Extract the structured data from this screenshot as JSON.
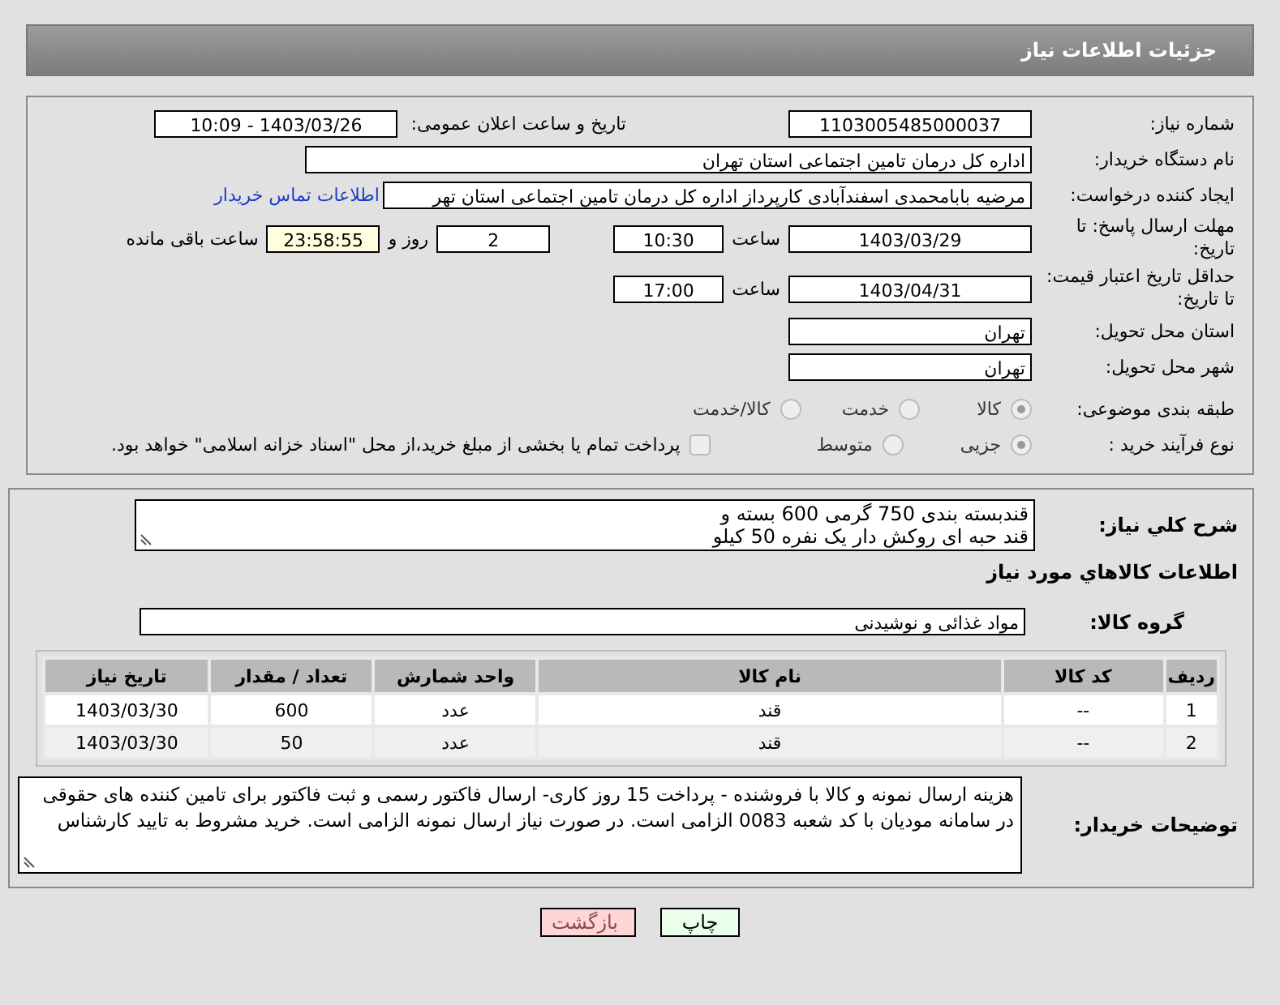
{
  "header": {
    "title": "جزئیات اطلاعات نیاز"
  },
  "need_number": {
    "label": "شماره نیاز:",
    "value": "1103005485000037"
  },
  "announce": {
    "label": "تاریخ و ساعت اعلان عمومی:",
    "value": "1403/03/26 - 10:09"
  },
  "buyer_org": {
    "label": "نام دستگاه خریدار:",
    "value": "اداره کل درمان تامین اجتماعی استان تهران"
  },
  "requester": {
    "label": "ایجاد کننده درخواست:",
    "value": "مرضیه بابامحمدی اسفندآبادی کارپرداز اداره کل درمان تامین اجتماعی استان تهر",
    "link": "اطلاعات تماس خریدار"
  },
  "response_deadline": {
    "label": "مهلت ارسال پاسخ: تا تاریخ:",
    "date": "1403/03/29",
    "time_label": "ساعت",
    "time": "10:30",
    "days": "2",
    "days_label": "روز و",
    "remaining": "23:58:55",
    "remaining_label": "ساعت باقی مانده"
  },
  "price_validity": {
    "label": "حداقل تاریخ اعتبار قیمت: تا تاریخ:",
    "date": "1403/04/31",
    "time_label": "ساعت",
    "time": "17:00"
  },
  "delivery_province": {
    "label": "استان محل تحویل:",
    "value": "تهران"
  },
  "delivery_city": {
    "label": "شهر محل تحویل:",
    "value": "تهران"
  },
  "category": {
    "label": "طبقه بندی موضوعی:",
    "options": [
      {
        "label": "کالا",
        "selected": true
      },
      {
        "label": "خدمت",
        "selected": false
      },
      {
        "label": "کالا/خدمت",
        "selected": false
      }
    ]
  },
  "purchase_type": {
    "label": "نوع فرآیند خرید :",
    "options": [
      {
        "label": "جزیی",
        "selected": true
      },
      {
        "label": "متوسط",
        "selected": false
      }
    ],
    "treasury": {
      "checked": false,
      "text": "پرداخت تمام یا بخشی از مبلغ خرید،از محل \"اسناد خزانه اسلامی\" خواهد بود."
    }
  },
  "description": {
    "label": "شرح کلي نياز:",
    "lines": [
      "قندبسته بندی 750 گرمی 600 بسته و",
      "قند حبه ای روکش دار یک نفره 50 کیلو"
    ]
  },
  "goods_heading": "اطلاعات کالاهاي مورد نياز",
  "goods_group": {
    "label": "گروه کالا:",
    "value": "مواد غذائی و نوشیدنی"
  },
  "table": {
    "columns": [
      "ردیف",
      "کد کالا",
      "نام کالا",
      "واحد شمارش",
      "تعداد / مقدار",
      "تاریخ نیاز"
    ],
    "rows": [
      [
        "1",
        "--",
        "قند",
        "عدد",
        "600",
        "1403/03/30"
      ],
      [
        "2",
        "--",
        "قند",
        "عدد",
        "50",
        "1403/03/30"
      ]
    ]
  },
  "buyer_notes": {
    "label": "توضیحات خریدار:",
    "value": "هزینه ارسال نمونه و کالا با فروشنده - پرداخت 15 روز کاری- ارسال فاکتور رسمی و ثبت فاکتور برای تامین کننده های حقوقی در سامانه مودیان با کد شعبه 0083 الزامی است. در صورت نیاز ارسال نمونه الزامی است. خرید مشروط به تایید کارشناس"
  },
  "buttons": [
    {
      "label": "چاپ",
      "kind": "print"
    },
    {
      "label": "بازگشت",
      "kind": "back"
    }
  ]
}
